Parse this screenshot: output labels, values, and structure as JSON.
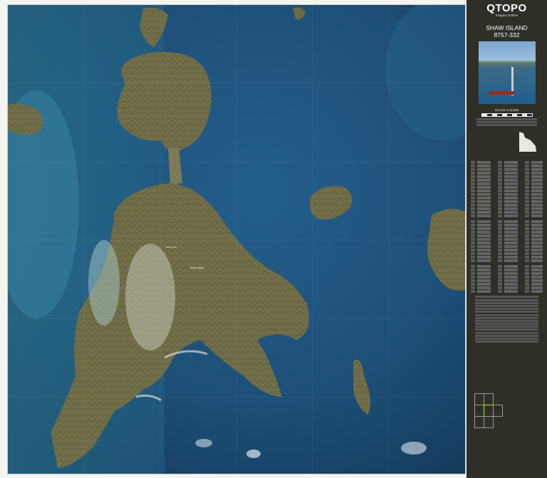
{
  "panel": {
    "brand": "QTOPO",
    "edition": "Imagery Edition",
    "map_name": "SHAW ISLAND",
    "map_number": "8757-332",
    "scale": "SCALE 1:10,000"
  },
  "map": {
    "place_labels": [
      "Shaw Island",
      "Shaw Peak"
    ]
  },
  "colors": {
    "deep_water": "#1f5a86",
    "shallow_water": "#3f8aa8",
    "reef": "#6fb3b8",
    "land": "#6b6a45",
    "sand": "#d9d6cc",
    "panel_bg": "#2f2f28"
  },
  "icons": [
    "map-image",
    "queensland-outline-icon",
    "photo-thumbnail"
  ]
}
